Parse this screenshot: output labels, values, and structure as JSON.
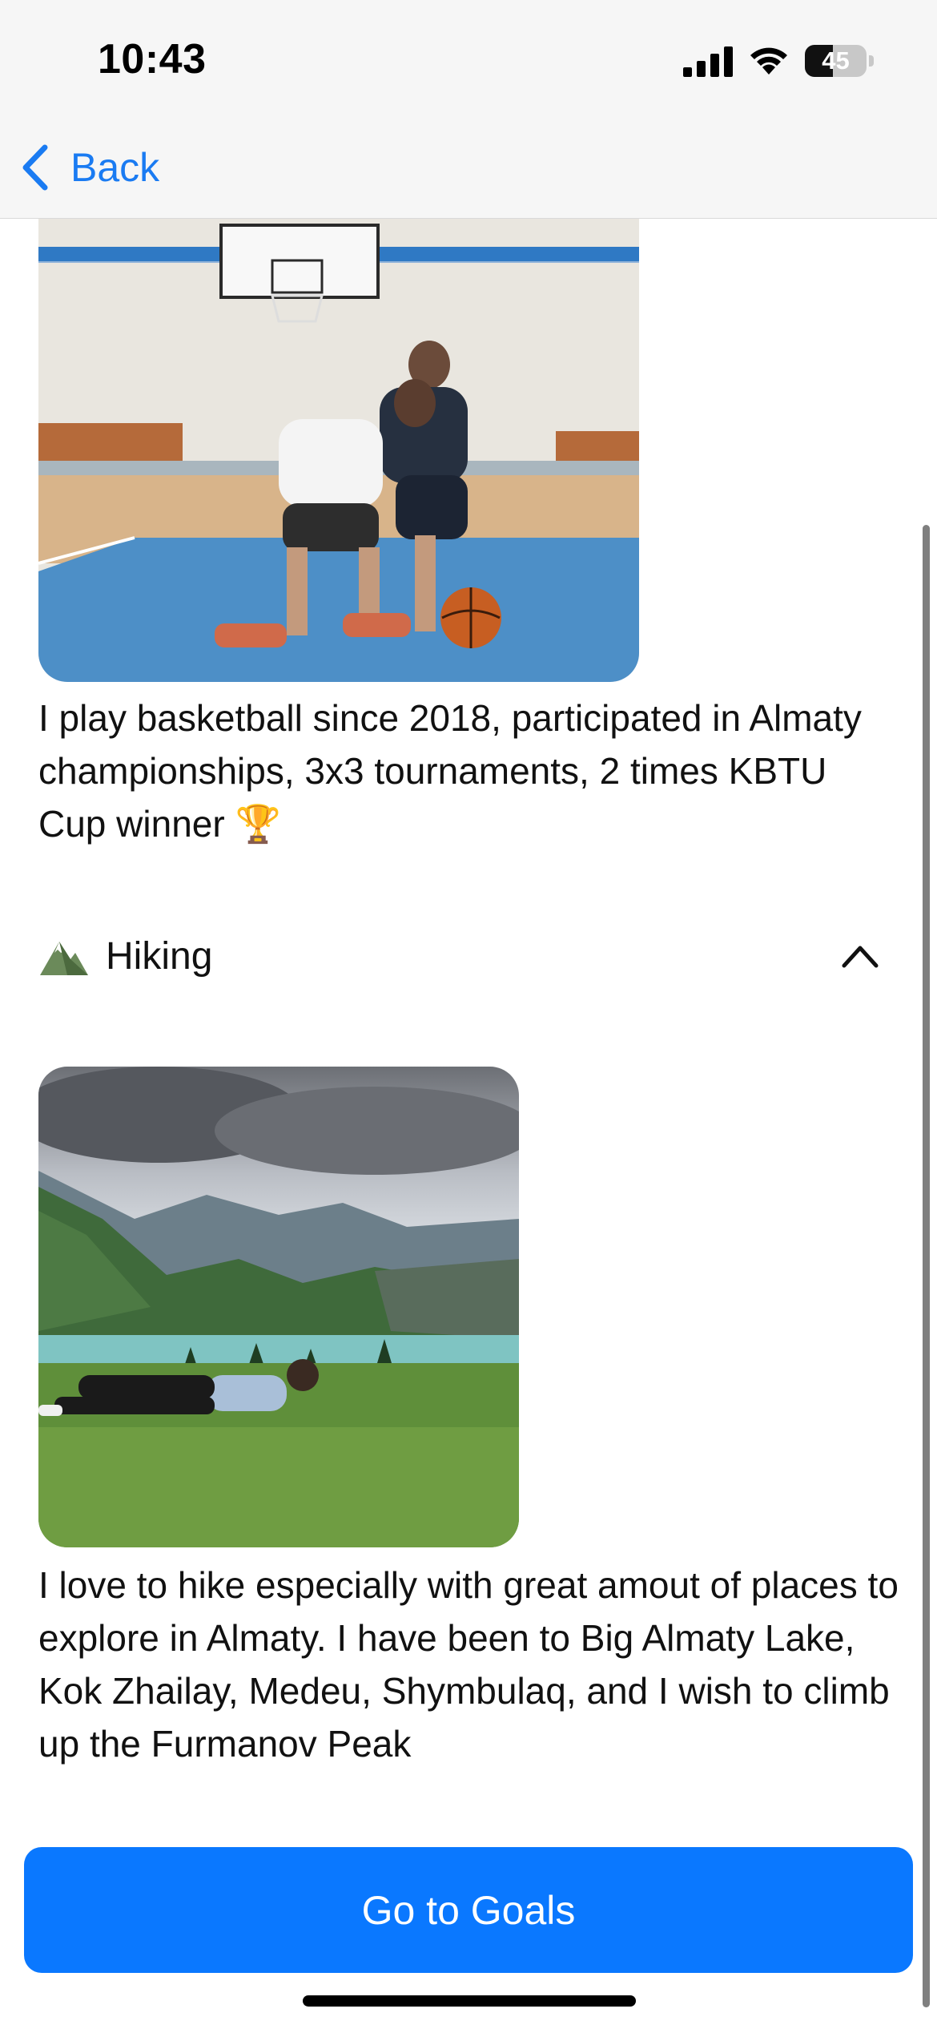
{
  "status_bar": {
    "time": "10:43",
    "battery_level": 45,
    "battery_label": "45"
  },
  "nav": {
    "back_label": "Back"
  },
  "sections": [
    {
      "photo_icon": "basketball-photo",
      "caption": "I play basketball since 2018, participated in Almaty championships, 3x3 tournaments, 2 times KBTU Cup winner 🏆"
    },
    {
      "title": "Hiking",
      "icon": "mountain-icon",
      "expanded": true,
      "photo_icon": "hiking-photo",
      "caption": "I love to hike especially with great amout of places to explore in Almaty. I have been to Big Almaty Lake, Kok Zhailay, Medeu, Shymbulaq, and I wish to climb up the Furmanov Peak"
    }
  ],
  "footer": {
    "button_label": "Go to Goals"
  },
  "colors": {
    "accent": "#0a78ff",
    "nav_tint": "#1a7bf2"
  }
}
